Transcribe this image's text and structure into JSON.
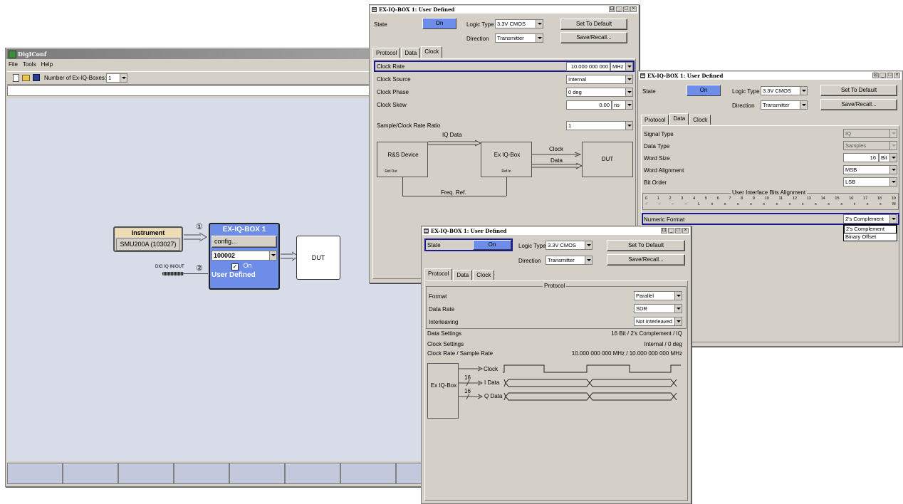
{
  "digiconf": {
    "title": "DigIConf",
    "menu": [
      "File",
      "Tools",
      "Help"
    ],
    "num_boxes_label": "Number of Ex-IQ-Boxes:",
    "num_boxes_value": "1",
    "instrument_header": "Instrument",
    "instrument_name": "SMU200A (103027)",
    "port1": "①",
    "port2": "②",
    "dig_iq_label": "DIG IQ IN/OUT",
    "box_title": "EX-IQ-BOX 1",
    "config_label": "config...",
    "serial_value": "100002",
    "on_label": "On",
    "user_defined": "User Defined",
    "dut_label": "DUT"
  },
  "clock_window": {
    "title": "EX-IQ-BOX 1: User Defined",
    "state_label": "State",
    "state_value": "On",
    "logic_type_label": "Logic Type",
    "logic_type_value": "3.3V CMOS",
    "direction_label": "Direction",
    "direction_value": "Transmitter",
    "set_default": "Set To Default",
    "save_recall": "Save/Recall...",
    "tabs": [
      "Protocol",
      "Data",
      "Clock"
    ],
    "clock_rate_label": "Clock Rate",
    "clock_rate_value": "10.000 000 000",
    "clock_rate_unit": "MHz",
    "clock_source_label": "Clock Source",
    "clock_source_value": "Internal",
    "clock_phase_label": "Clock Phase",
    "clock_phase_value": "0 deg",
    "clock_skew_label": "Clock Skew",
    "clock_skew_value": "0.00",
    "clock_skew_unit": "ns",
    "ratio_label": "Sample/Clock Rate Ratio",
    "ratio_value": "1",
    "diagram": {
      "rs_device": "R&S Device",
      "ref_out": "Ref.Out",
      "iq_data": "IQ Data",
      "ex_box": "Ex IQ-Box",
      "ref_in": "Ref.In",
      "clock": "Clock",
      "data": "Data",
      "dut": "DUT",
      "freq_ref": "Freq. Ref."
    }
  },
  "data_window": {
    "title": "EX-IQ-BOX 1: User Defined",
    "state_label": "State",
    "state_value": "On",
    "logic_type_label": "Logic Type",
    "logic_type_value": "3.3V CMOS",
    "direction_label": "Direction",
    "direction_value": "Transmitter",
    "set_default": "Set To Default",
    "save_recall": "Save/Recall...",
    "tabs": [
      "Protocol",
      "Data",
      "Clock"
    ],
    "signal_type_label": "Signal Type",
    "signal_type_value": "IQ",
    "data_type_label": "Data Type",
    "data_type_value": "Samples",
    "word_size_label": "Word Size",
    "word_size_value": "16",
    "word_size_unit": "Bit",
    "word_align_label": "Word Alignment",
    "word_align_value": "MSB",
    "bit_order_label": "Bit Order",
    "bit_order_value": "LSB",
    "bits_group_label": "User Interface Bits Alignment",
    "bit_numbers": [
      "0",
      "1",
      "2",
      "3",
      "4",
      "5",
      "6",
      "7",
      "8",
      "9",
      "10",
      "11",
      "12",
      "13",
      "14",
      "15",
      "16",
      "17",
      "18",
      "19"
    ],
    "bit_marks": [
      "–",
      "–",
      "–",
      "–",
      "L",
      "x",
      "x",
      "x",
      "x",
      "x",
      "x",
      "x",
      "x",
      "x",
      "x",
      "x",
      "x",
      "x",
      "x",
      "M"
    ],
    "numeric_format_label": "Numeric Format",
    "numeric_format_value": "2's Complement",
    "numeric_options": [
      "2's Complement",
      "Binary Offset"
    ]
  },
  "protocol_window": {
    "title": "EX-IQ-BOX 1: User Defined",
    "state_label": "State",
    "state_value": "On",
    "logic_type_label": "Logic Type",
    "logic_type_value": "3.3V CMOS",
    "direction_label": "Direction",
    "direction_value": "Transmitter",
    "set_default": "Set To Default",
    "save_recall": "Save/Recall...",
    "tabs": [
      "Protocol",
      "Data",
      "Clock"
    ],
    "group_label": "Protocol",
    "format_label": "Format",
    "format_value": "Parallel",
    "data_rate_label": "Data Rate",
    "data_rate_value": "SDR",
    "interleaving_label": "Interleaving",
    "interleaving_value": "Not Interleaved",
    "data_settings_label": "Data Settings",
    "data_settings_value": "16  Bit  /  2's Complement  /  IQ",
    "clock_settings_label": "Clock Settings",
    "clock_settings_value": "Internal  /  0 deg",
    "clock_rate_label": "Clock Rate / Sample Rate",
    "clock_rate_value": "10.000 000 000  MHz  /  10.000 000 000  MHz",
    "timing": {
      "ex_box": "Ex IQ-Box",
      "clock": "Clock",
      "i_data": "I Data",
      "q_data": "Q Data",
      "bits_i": "16",
      "bits_q": "16"
    }
  }
}
